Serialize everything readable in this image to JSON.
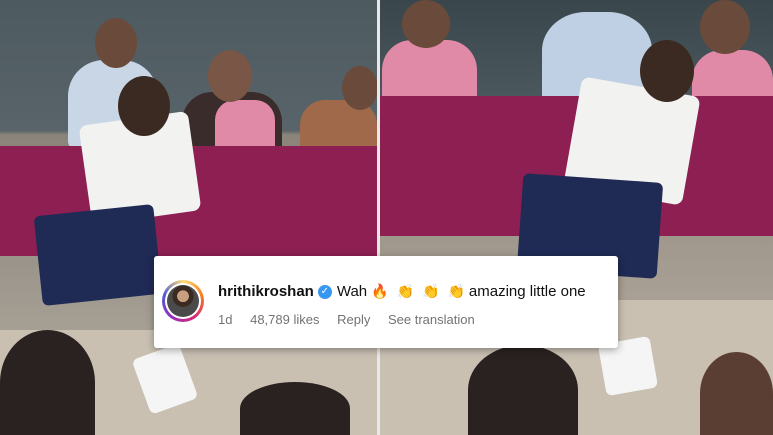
{
  "comment": {
    "username": "hrithikroshan",
    "verified_icon": "verified-badge-icon",
    "text_prefix": "Wah",
    "emojis": [
      "🔥",
      "👏",
      "👏",
      "👏"
    ],
    "text_suffix": "amazing little one",
    "age": "1d",
    "likes": "48,789 likes",
    "reply_label": "Reply",
    "translate_label": "See translation"
  },
  "colors": {
    "table_cloth": "#8d1f52",
    "verified": "#3897f0",
    "meta_text": "#737373"
  }
}
